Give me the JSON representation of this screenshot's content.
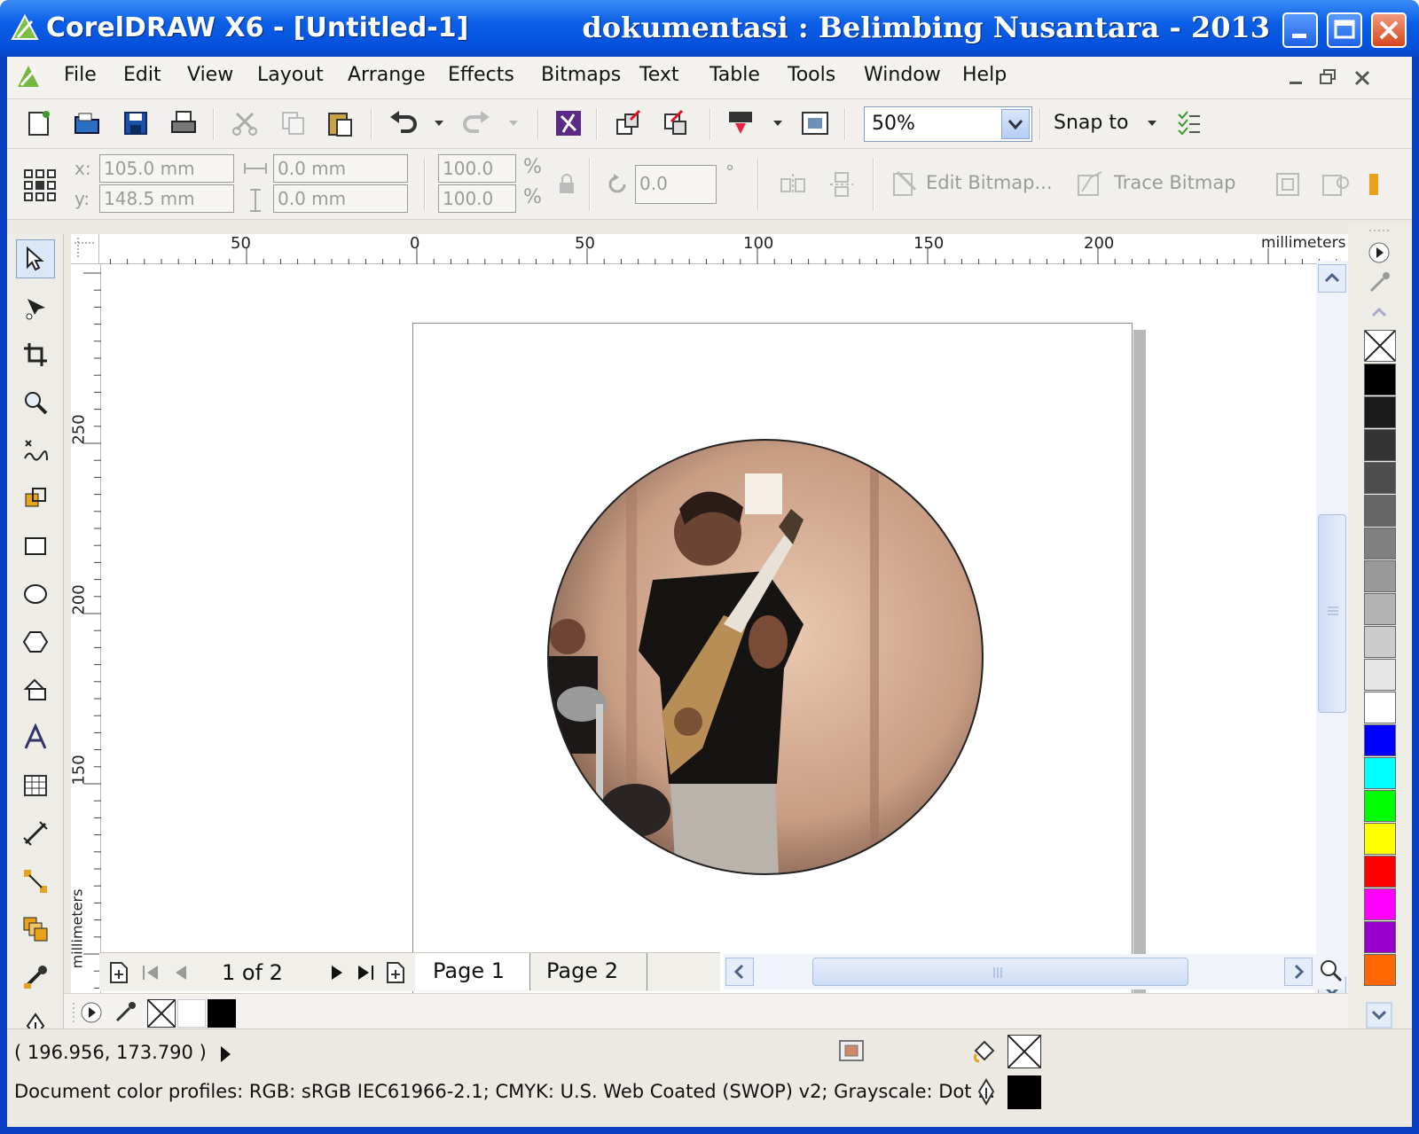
{
  "titlebar": {
    "app_title": "CorelDRAW X6 - [Untitled-1]",
    "credit": "dokumentasi : Belimbing Nusantara - 2013"
  },
  "menu": [
    "File",
    "Edit",
    "View",
    "Layout",
    "Arrange",
    "Effects",
    "Bitmaps",
    "Text",
    "Table",
    "Tools",
    "Window",
    "Help"
  ],
  "standard_toolbar": {
    "zoom_value": "50%",
    "snap_to_label": "Snap to"
  },
  "property_bar": {
    "x_label": "x:",
    "y_label": "y:",
    "x_value": "105.0 mm",
    "y_value": "148.5 mm",
    "width_value": "0.0 mm",
    "height_value": "0.0 mm",
    "scale_x": "100.0",
    "scale_y": "100.0",
    "percent_symbol": "%",
    "rotation_value": "0.0",
    "degree_symbol": "°",
    "edit_bitmap_label": "Edit Bitmap...",
    "trace_bitmap_label": "Trace Bitmap"
  },
  "ruler": {
    "top_labels": [
      "50",
      "0",
      "50",
      "100",
      "150",
      "200"
    ],
    "units": "millimeters",
    "left_labels": [
      "250",
      "200",
      "150"
    ],
    "left_units": "millimeters"
  },
  "page_nav": {
    "page_counter": "1 of 2",
    "tabs": [
      "Page 1",
      "Page 2"
    ]
  },
  "status": {
    "cursor_coords": "( 196.956, 173.790 )",
    "color_profiles": "Document color profiles: RGB: sRGB IEC61966-2.1; CMYK: U.S. Web Coated (SWOP) v2; Grayscale: Dot ..."
  },
  "colors": {
    "titlebar": "#0b5fe6",
    "palette": [
      "#000000",
      "#1a1a1a",
      "#333333",
      "#4d4d4d",
      "#666666",
      "#808080",
      "#999999",
      "#b3b3b3",
      "#cccccc",
      "#e6e6e6",
      "#ffffff",
      "#0000ff",
      "#00ffff",
      "#00ff00",
      "#ffff00",
      "#ff0000",
      "#ff00ff",
      "#9900cc",
      "#ff6600"
    ]
  },
  "icons": [
    "coreldraw-logo-icon",
    "new-document-icon",
    "open-folder-icon",
    "save-icon",
    "print-icon",
    "cut-icon",
    "copy-icon",
    "paste-icon",
    "undo-icon",
    "redo-icon",
    "corel-connect-icon",
    "import-icon",
    "export-icon",
    "publish-pdf-icon",
    "full-screen-preview-icon",
    "pick-tool-icon",
    "shape-tool-icon",
    "crop-tool-icon",
    "zoom-tool-icon",
    "freehand-tool-icon",
    "smart-fill-icon",
    "rectangle-tool-icon",
    "ellipse-tool-icon",
    "polygon-tool-icon",
    "basic-shapes-icon",
    "text-tool-icon",
    "table-tool-icon",
    "dimension-tool-icon",
    "connector-tool-icon",
    "blend-tool-icon",
    "eyedropper-tool-icon",
    "outline-pen-icon",
    "fill-icon"
  ]
}
